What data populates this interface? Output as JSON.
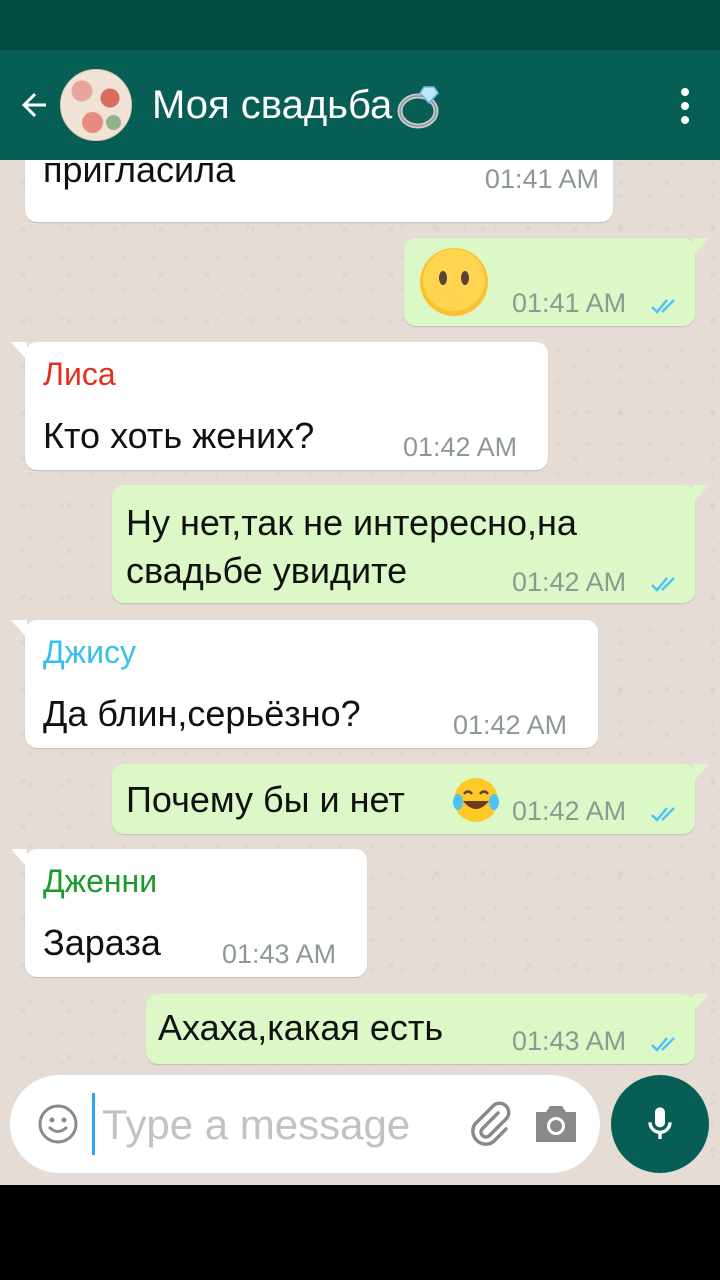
{
  "header": {
    "title": "Моя свадьба",
    "ring_emoji_icon": "ring-icon",
    "back_icon": "arrow-left-icon",
    "menu_icon": "more-vert-icon"
  },
  "messages": [
    {
      "type": "in",
      "text": "пригласила",
      "time": "01:41 AM"
    },
    {
      "type": "out",
      "emoji": "face-without-mouth",
      "time": "01:41 AM",
      "status": "read"
    },
    {
      "type": "in",
      "sender": "Лиса",
      "sender_color": "#e0301e",
      "text": "Кто хоть жених?",
      "time": "01:42 AM"
    },
    {
      "type": "out",
      "text_line1": "Ну нет,так не интересно,на",
      "text_line2": "свадьбе увидите",
      "time": "01:42 AM",
      "status": "read"
    },
    {
      "type": "in",
      "sender": "Джису",
      "sender_color": "#35c1ea",
      "text": "Да блин,серьёзно?",
      "time": "01:42 AM"
    },
    {
      "type": "out",
      "text": "Почему бы и нет",
      "emoji": "face-with-tears-of-joy",
      "time": "01:42 AM",
      "status": "read"
    },
    {
      "type": "in",
      "sender": "Дженни",
      "sender_color": "#1a9a2a",
      "text": "Зараза",
      "time": "01:43 AM"
    },
    {
      "type": "out",
      "text": "Ахаха,какая есть",
      "time": "01:43 AM",
      "status": "read"
    }
  ],
  "composer": {
    "placeholder": "Type a message",
    "emoji_icon": "smiley-icon",
    "attach_icon": "paperclip-icon",
    "camera_icon": "camera-icon",
    "mic_icon": "mic-icon"
  },
  "colors": {
    "header_bg": "#075e54",
    "outgoing_bubble": "#dcf8c6",
    "incoming_bubble": "#ffffff",
    "read_ticks": "#4fc3f7"
  }
}
